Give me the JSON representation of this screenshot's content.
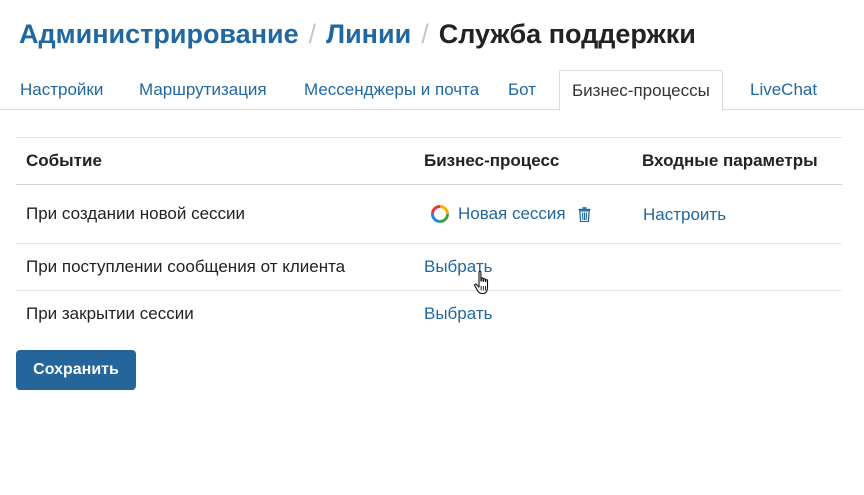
{
  "breadcrumb": {
    "items": [
      "Администрирование",
      "Линии"
    ],
    "separator": "/",
    "current": "Служба поддержки"
  },
  "tabs": [
    {
      "label": "Настройки",
      "active": false
    },
    {
      "label": "Маршрутизация",
      "active": false
    },
    {
      "label": "Мессенджеры и почта",
      "active": false
    },
    {
      "label": "Бот",
      "active": false
    },
    {
      "label": "Бизнес-процессы",
      "active": true
    },
    {
      "label": "LiveChat",
      "active": false
    }
  ],
  "table": {
    "headers": {
      "event": "Событие",
      "process": "Бизнес-процесс",
      "params": "Входные параметры"
    },
    "rows": [
      {
        "event": "При создании новой сессии",
        "process": "Новая сессия",
        "params": "Настроить"
      },
      {
        "event": "При поступлении сообщения от клиента",
        "process": "Выбрать",
        "params": ""
      },
      {
        "event": "При закрытии сессии",
        "process": "Выбрать",
        "params": ""
      }
    ]
  },
  "icons": {
    "process": "process-ring-icon",
    "delete": "trash-icon",
    "cursor": "hand-pointer-cursor-icon"
  },
  "colors": {
    "link": "#2168a0",
    "primary_button": "#24669c"
  },
  "actions": {
    "save_label": "Сохранить"
  }
}
